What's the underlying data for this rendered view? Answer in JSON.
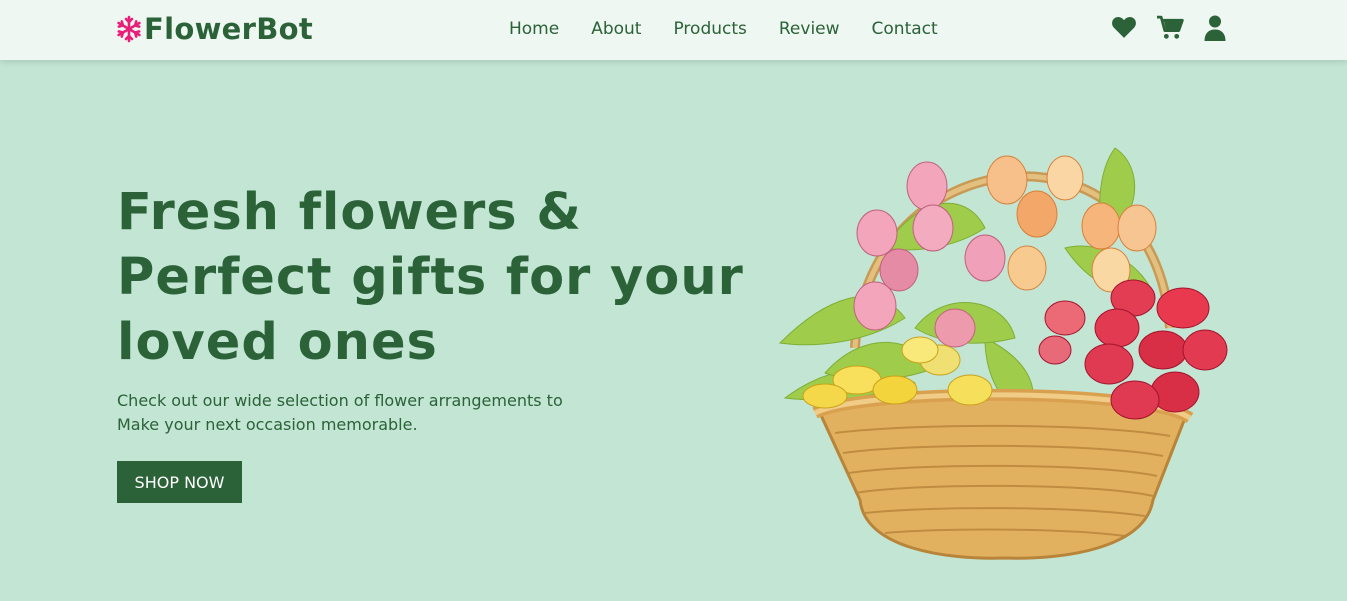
{
  "brand": {
    "name": "FlowerBot",
    "icon": "snowflake-icon",
    "icon_color": "#e91e78"
  },
  "nav": [
    {
      "label": "Home"
    },
    {
      "label": "About"
    },
    {
      "label": "Products"
    },
    {
      "label": "Review"
    },
    {
      "label": "Contact"
    }
  ],
  "header_icons": [
    "heart-icon",
    "cart-icon",
    "user-icon"
  ],
  "hero": {
    "title": "Fresh flowers & Perfect gifts for your loved ones",
    "subtitle": "Check out our wide selection of flower arrangements to Make your next occasion memorable.",
    "cta": "SHOP NOW",
    "image": "flower-basket-image"
  },
  "colors": {
    "primary": "#2b6238",
    "background": "#c2e5d4",
    "header_bg": "#eef7f1",
    "accent": "#e91e78"
  }
}
